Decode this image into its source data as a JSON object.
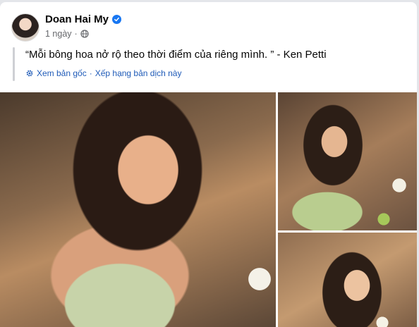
{
  "post": {
    "author_name": "Doan Hai My",
    "verified": true,
    "timestamp": "1 ngày",
    "separator": "·",
    "privacy_icon": "globe-icon",
    "quote_text": "“Mỗi bông hoa nở rộ theo thời điểm của riêng mình. ” - Ken Petti",
    "translation": {
      "icon": "gear-icon",
      "view_original_label": "Xem bản gốc",
      "separator": "·",
      "rate_translation_label": "Xếp hạng bản dịch này"
    },
    "photos": [
      {
        "name": "photo-main"
      },
      {
        "name": "photo-top-right"
      },
      {
        "name": "photo-bottom-right"
      }
    ]
  },
  "colors": {
    "link_blue": "#1f5bb8",
    "verified_blue": "#1877f2",
    "secondary_text": "#65676b",
    "primary_text": "#050505"
  }
}
